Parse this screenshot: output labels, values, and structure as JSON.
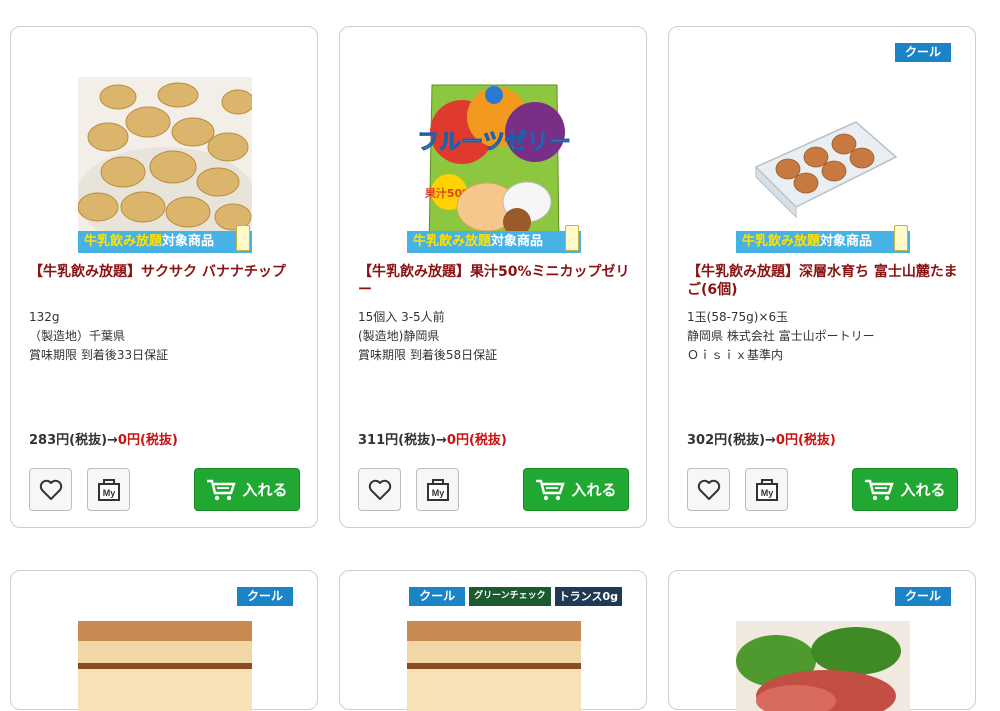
{
  "products": [
    {
      "badges": [],
      "campaign_banner": {
        "highlight": "牛乳飲み放題",
        "suffix": "対象商品"
      },
      "title": "【牛乳飲み放題】サクサク バナナチップ",
      "desc": [
        "132g",
        "（製造地）千葉県",
        "賞味期限 到着後33日保証"
      ],
      "price_prefix": "283円(税抜)→",
      "price_now": "0円(税抜)",
      "add_label": "入れる",
      "my_label": "My",
      "photo_icon": "banana-chips-image"
    },
    {
      "badges": [],
      "campaign_banner": {
        "highlight": "牛乳飲み放題",
        "suffix": "対象商品"
      },
      "title": "【牛乳飲み放題】果汁50%ミニカップゼリー",
      "desc": [
        "15個入 3-5人前",
        "(製造地)静岡県",
        "賞味期限 到着後58日保証"
      ],
      "price_prefix": "311円(税抜)→",
      "price_now": "0円(税抜)",
      "add_label": "入れる",
      "my_label": "My",
      "photo_icon": "fruit-jelly-package-image",
      "package_text": {
        "title": "フルーツゼリー",
        "juice": "果汁50%"
      }
    },
    {
      "badges": [
        {
          "label": "クール",
          "type": "cool"
        }
      ],
      "campaign_banner": {
        "highlight": "牛乳飲み放題",
        "suffix": "対象商品"
      },
      "title": "【牛乳飲み放題】深層水育ち 富士山麓たまご(6個)",
      "desc": [
        "1玉(58-75g)×6玉",
        "静岡県 株式会社 富士山ポートリー",
        "Ｏｉｓｉｘ基準内"
      ],
      "price_prefix": "302円(税抜)→",
      "price_now": "0円(税抜)",
      "add_label": "入れる",
      "my_label": "My",
      "photo_icon": "eggs-carton-image"
    }
  ],
  "row2": [
    {
      "badges": [
        {
          "label": "クール",
          "type": "cool"
        }
      ],
      "photo_icon": "castella-cake-image"
    },
    {
      "badges": [
        {
          "label": "クール",
          "type": "cool"
        },
        {
          "label": "グリーンチェック",
          "type": "green"
        },
        {
          "label": "トランス0g",
          "type": "trans"
        }
      ],
      "photo_icon": "castella-cake-image"
    },
    {
      "badges": [
        {
          "label": "クール",
          "type": "cool"
        }
      ],
      "photo_icon": "ham-salad-image"
    }
  ],
  "colors": {
    "title": "#8c1111",
    "price_now": "#cc1111",
    "cart_button": "#21a833",
    "cool_badge": "#1a84c7",
    "banner": "#46b2e6"
  }
}
